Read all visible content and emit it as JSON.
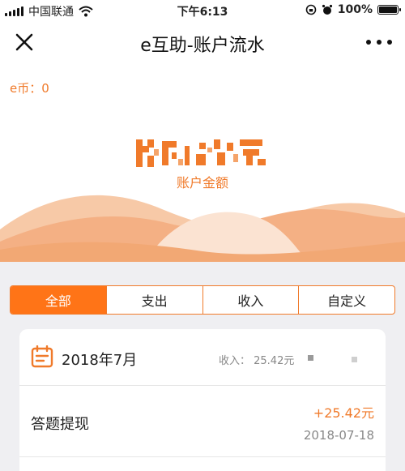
{
  "status_bar": {
    "carrier": "中国联通",
    "time": "下午6:13",
    "battery": "100%"
  },
  "nav": {
    "title": "e互助-账户流水",
    "close_icon": "close-icon",
    "more_icon": "more-icon"
  },
  "header": {
    "ecoin_label": "e币：0",
    "amount_label": "账户金额",
    "accent_color": "#f07a2a"
  },
  "tabs": [
    {
      "label": "全部",
      "active": true
    },
    {
      "label": "支出",
      "active": false
    },
    {
      "label": "收入",
      "active": false
    },
    {
      "label": "自定义",
      "active": false
    }
  ],
  "ledger": {
    "month": "2018年7月",
    "income_summary": "收入： 25.42元",
    "records": [
      {
        "title": "答题提现",
        "amount": "+25.42元",
        "date": "2018-07-18"
      }
    ]
  }
}
